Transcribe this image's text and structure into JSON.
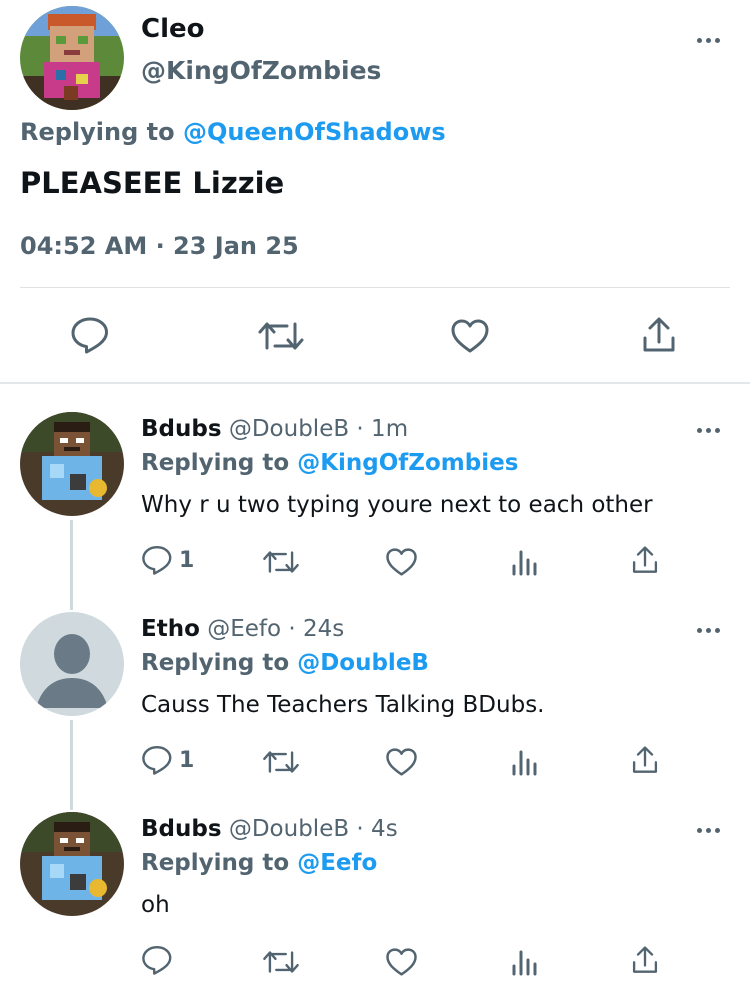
{
  "main_tweet": {
    "display_name": "Cleo",
    "handle": "@KingOfZombies",
    "replying_label": "Replying to",
    "replying_to": "@QueenOfShadows",
    "text": "PLEASEEE Lizzie",
    "timestamp": "04:52 AM · 23 Jan 25",
    "avatar_icon": "minecraft-skin-avatar"
  },
  "replies": [
    {
      "display_name": "Bdubs",
      "handle_time": "@DoubleB · 1m",
      "replying_label": "Replying to",
      "replying_to": "@KingOfZombies",
      "text": "Why r u two typing youre next to each other",
      "reply_count": "1",
      "avatar_icon": "minecraft-skin-avatar"
    },
    {
      "display_name": "Etho",
      "handle_time": "@Eefo · 24s",
      "replying_label": "Replying to",
      "replying_to": "@DoubleB",
      "text": "Causs The Teachers Talking BDubs.",
      "reply_count": "1",
      "avatar_icon": "default-profile-avatar"
    },
    {
      "display_name": "Bdubs",
      "handle_time": "@DoubleB · 4s",
      "replying_label": "Replying to",
      "replying_to": "@Eefo",
      "text": "oh",
      "reply_count": "",
      "avatar_icon": "minecraft-skin-avatar"
    }
  ],
  "icons": [
    "reply-icon",
    "retweet-icon",
    "like-icon",
    "views-icon",
    "share-icon",
    "more-icon"
  ],
  "colors": {
    "link": "#1d9bf0",
    "secondary_text": "#536471",
    "primary_text": "#0f1419",
    "divider": "#dfe3e6"
  }
}
